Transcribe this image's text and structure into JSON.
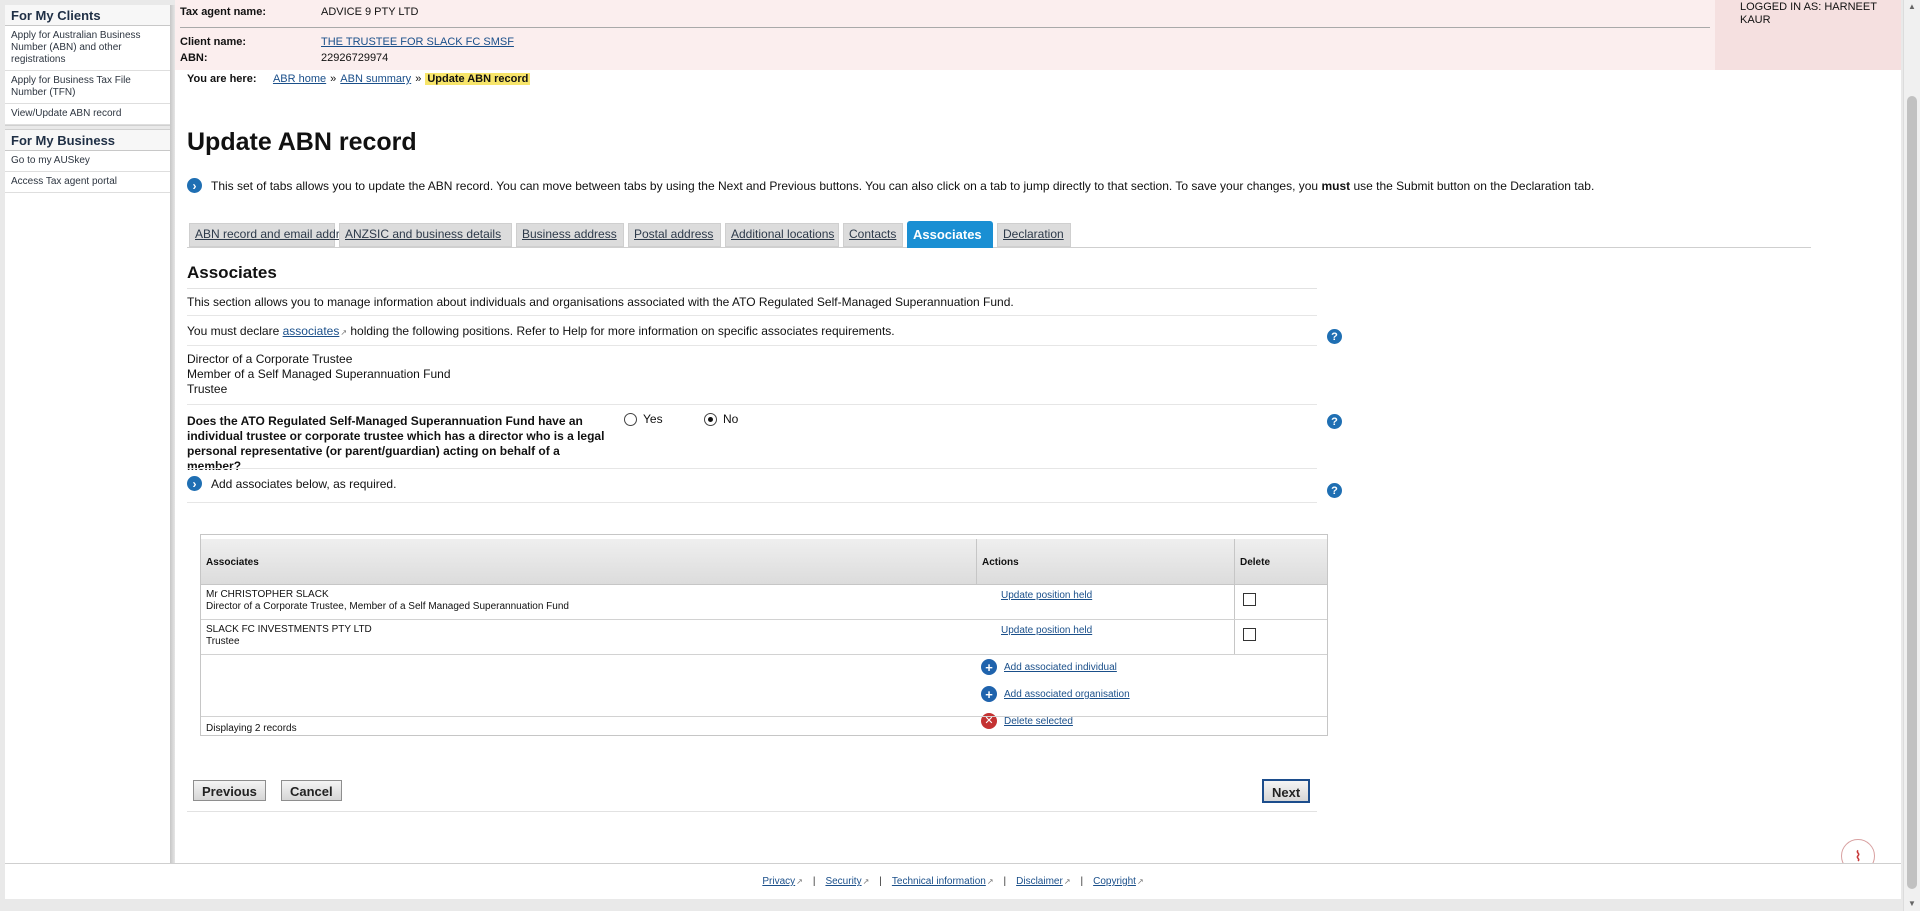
{
  "sidebar": {
    "clients_heading": "For My Clients",
    "clients_items": [
      {
        "label": "Apply for Australian Business Number (ABN) and other registrations"
      },
      {
        "label": "Apply for Business Tax File Number (TFN)"
      },
      {
        "label": "View/Update ABN record"
      }
    ],
    "business_heading": "For My Business",
    "business_items": [
      {
        "label": "Go to my AUSkey"
      },
      {
        "label": "Access Tax agent portal"
      }
    ]
  },
  "agent": {
    "tax_agent_label": "Tax agent name:",
    "tax_agent_value": "ADVICE 9 PTY LTD",
    "client_label": "Client name:",
    "client_value": "THE TRUSTEE FOR SLACK FC SMSF",
    "abn_label": "ABN:",
    "abn_value": "22926729974",
    "logged_in": "LOGGED IN AS: HARNEET KAUR"
  },
  "breadcrumb": {
    "here_label": "You are here:",
    "items": [
      "ABR home",
      "ABN summary"
    ],
    "sep": "»",
    "current": "Update ABN record"
  },
  "page": {
    "title": "Update ABN record",
    "intro_before": "This set of tabs allows you to update the ABN record. You can move between tabs by using the Next and Previous buttons. You can also click on a tab to jump directly to that section. To save your changes, you ",
    "intro_bold": "must",
    "intro_after": " use the Submit button on the Declaration tab."
  },
  "tabs": [
    {
      "label": "ABN record and email address"
    },
    {
      "label": "ANZSIC and business details"
    },
    {
      "label": "Business address"
    },
    {
      "label": "Postal address"
    },
    {
      "label": "Additional locations"
    },
    {
      "label": "Contacts"
    },
    {
      "label": "Associates",
      "active": true
    },
    {
      "label": "Declaration"
    }
  ],
  "section": {
    "title": "Associates",
    "desc": "This section allows you to manage information about individuals and organisations associated with the ATO Regulated Self-Managed Superannuation Fund.",
    "declare_before": "You must declare ",
    "declare_link": "associates",
    "declare_after": " holding the following positions. Refer to Help for more information on specific associates requirements.",
    "positions": [
      "Director of a Corporate Trustee",
      "Member of a Self Managed Superannuation Fund",
      "Trustee"
    ],
    "question": "Does the ATO Regulated Self-Managed Superannuation Fund have an individual trustee or corporate trustee which has a director who is a legal personal representative (or parent/guardian) acting on behalf of a member?",
    "yes_label": "Yes",
    "no_label": "No",
    "selected": "No",
    "add_note": "Add associates below, as required."
  },
  "table": {
    "headers": {
      "associates": "Associates",
      "actions": "Actions",
      "delete": "Delete"
    },
    "rows": [
      {
        "name": "Mr CHRISTOPHER SLACK",
        "positions": "Director of a Corporate Trustee, Member of a Self Managed Superannuation Fund",
        "action": "Update position held",
        "checked": false
      },
      {
        "name": "SLACK FC INVESTMENTS PTY LTD",
        "positions": "Trustee",
        "action": "Update position held",
        "checked": false
      }
    ],
    "add_individual": "Add associated individual",
    "add_organisation": "Add associated organisation",
    "delete_selected": "Delete selected",
    "records": "Displaying 2 records"
  },
  "buttons": {
    "previous": "Previous",
    "cancel": "Cancel",
    "next": "Next"
  },
  "footer": {
    "links": [
      "Privacy",
      "Security",
      "Technical information",
      "Disclaimer",
      "Copyright"
    ],
    "sep": "|"
  },
  "icons": {
    "help": "help-icon",
    "arrow": "arrow-right-icon",
    "pdf": "pdf-icon",
    "external": "external-link-icon"
  }
}
